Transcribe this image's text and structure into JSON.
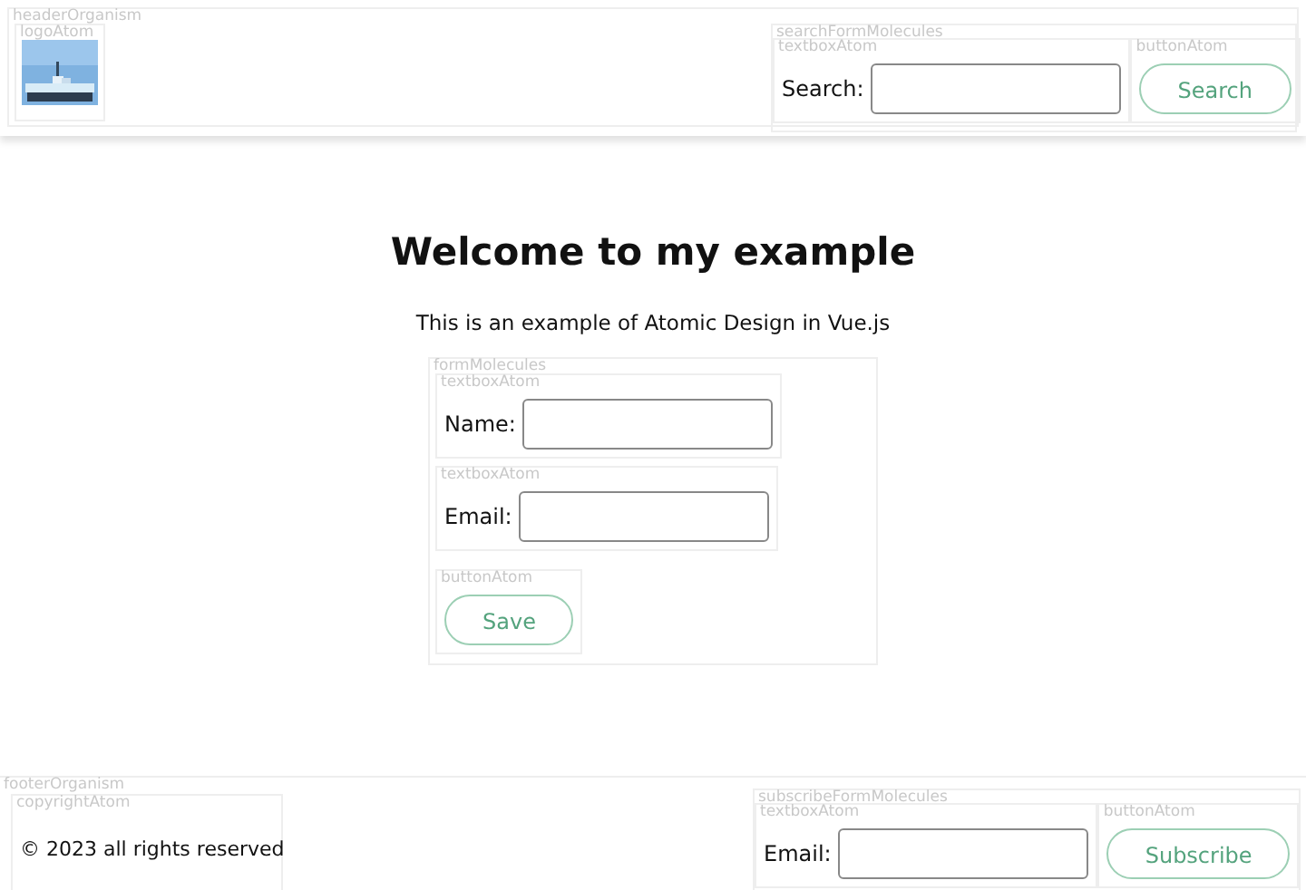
{
  "header": {
    "label": "headerOrganism",
    "logo": {
      "label": "logoAtom",
      "kind": "picture"
    },
    "search_form": {
      "label": "searchFormMolecules",
      "textbox": {
        "label": "textboxAtom",
        "field_label": "Search:"
      },
      "button": {
        "label": "buttonAtom",
        "text": "Search"
      }
    }
  },
  "main": {
    "title": "Welcome to my example",
    "subtitle": "This is an example of Atomic Design in Vue.js",
    "form": {
      "label": "formMolecules",
      "textboxes": [
        {
          "label": "textboxAtom",
          "field_label": "Name:"
        },
        {
          "label": "textboxAtom",
          "field_label": "Email:"
        }
      ],
      "button": {
        "label": "buttonAtom",
        "text": "Save"
      }
    }
  },
  "footer": {
    "label": "footerOrganism",
    "copyright": {
      "label": "copyrightAtom",
      "text": "© 2023 all rights reserved"
    },
    "subscribe_form": {
      "label": "subscribeFormMolecules",
      "textbox": {
        "label": "textboxAtom",
        "field_label": "Email:"
      },
      "button": {
        "label": "buttonAtom",
        "text": "Subscribe"
      }
    }
  }
}
